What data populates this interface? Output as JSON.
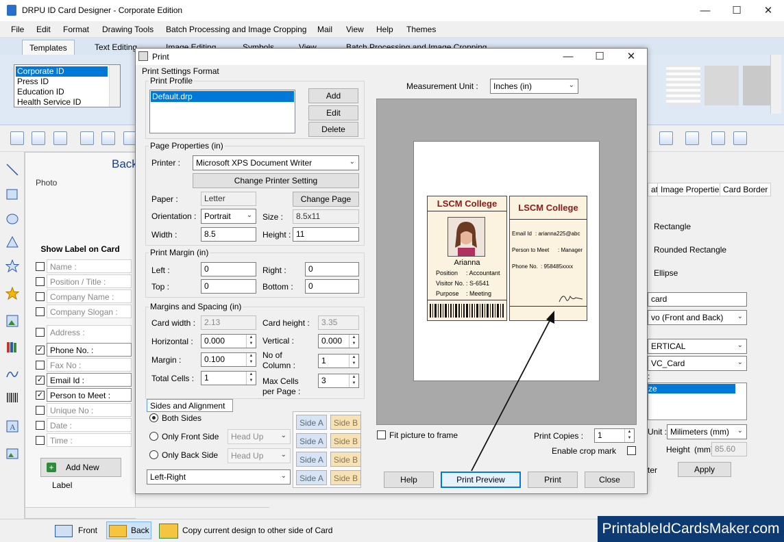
{
  "app": {
    "title": "DRPU ID Card Designer - Corporate Edition",
    "win_min": "—",
    "win_max": "☐",
    "win_close": "✕"
  },
  "menu": [
    "File",
    "Edit",
    "Format",
    "Drawing Tools",
    "Batch Processing and Image Cropping",
    "Mail",
    "View",
    "Help",
    "Themes"
  ],
  "tabs": [
    "Templates",
    "Text Editing",
    "Image Editing",
    "Symbols",
    "View",
    "Batch Processing and Image Cropping"
  ],
  "template_list": [
    "Corporate ID",
    "Press ID",
    "Education ID",
    "Health Service ID"
  ],
  "canvas": {
    "back_label": "Back"
  },
  "left_panel": {
    "photo_label": "Photo",
    "show_label_heading": "Show Label on Card",
    "labels": [
      {
        "text": "Name :",
        "checked": false
      },
      {
        "text": "Position / Title :",
        "checked": false
      },
      {
        "text": "Company Name :",
        "checked": false
      },
      {
        "text": "Company Slogan :",
        "checked": false
      },
      {
        "text": "Address :",
        "checked": false
      },
      {
        "text": "Phone No. :",
        "checked": true
      },
      {
        "text": "Fax No :",
        "checked": false
      },
      {
        "text": "Email Id :",
        "checked": true
      },
      {
        "text": "Person to Meet :",
        "checked": true
      },
      {
        "text": "Unique No :",
        "checked": false
      },
      {
        "text": "Date :",
        "checked": false
      },
      {
        "text": "Time :",
        "checked": false
      }
    ],
    "add_label_btn": "Add New Label"
  },
  "status": {
    "front": "Front",
    "back": "Back",
    "copy": "Copy current design to other side of Card"
  },
  "right_panel": {
    "tabs": [
      "at",
      "Image Properties",
      "Card Border"
    ],
    "shapes": [
      "Rectangle",
      "Rounded Rectangle",
      "Ellipse"
    ],
    "card_name": "card",
    "sides_combo": "vo (Front and Back)",
    "orientation_combo": "ERTICAL",
    "card_combo": "VC_Card",
    "colon": ":",
    "list_selected": "ze",
    "unit_label": "Unit :",
    "unit_value": "Milimeters (mm)",
    "height_label": "Height",
    "height_unit": "(mm)",
    "height_value": "85.60",
    "partial_btn": "ter",
    "apply_btn": "Apply"
  },
  "watermark": "PrintableIdCardsMaker.com",
  "dialog": {
    "title": "Print",
    "settings_format": "Print Settings Format",
    "print_profile": {
      "label": "Print Profile",
      "items": [
        "Default.drp"
      ],
      "add": "Add",
      "edit": "Edit",
      "delete": "Delete"
    },
    "page_props": {
      "label": "Page Properties  (in)",
      "printer_label": "Printer :",
      "printer_value": "Microsoft XPS Document Writer",
      "change_printer": "Change Printer Setting",
      "paper_label": "Paper :",
      "paper_value": "Letter",
      "change_page": "Change Page",
      "orientation_label": "Orientation :",
      "orientation_value": "Portrait",
      "size_label": "Size :",
      "size_value": "8.5x11",
      "width_label": "Width :",
      "width_value": "8.5",
      "height_label": "Height :",
      "height_value": "11"
    },
    "margin": {
      "label": "Print Margin (in)",
      "left_label": "Left :",
      "left_value": "0",
      "right_label": "Right :",
      "right_value": "0",
      "top_label": "Top :",
      "top_value": "0",
      "bottom_label": "Bottom :",
      "bottom_value": "0"
    },
    "spacing": {
      "label": "Margins and Spacing  (in)",
      "card_width_label": "Card width :",
      "card_width_value": "2.13",
      "card_height_label": "Card height :",
      "card_height_value": "3.35",
      "horizontal_label": "Horizontal :",
      "horizontal_value": "0.000",
      "vertical_label": "Vertical :",
      "vertical_value": "0.000",
      "margin_label": "Margin :",
      "margin_value": "0.100",
      "no_of_label": "No of",
      "column_label": "Column :",
      "column_value": "1",
      "total_cells_label": "Total Cells :",
      "total_cells_value": "1",
      "max_cells_label": "Max Cells",
      "per_page_label": "per Page :",
      "max_cells_value": "3"
    },
    "sides": {
      "label": "Sides and Alignment",
      "both": "Both Sides",
      "front_only": "Only Front Side",
      "back_only": "Only Back Side",
      "head_up_1": "Head Up",
      "head_up_2": "Head Up",
      "alignment": "Left-Right",
      "side_a": "Side A",
      "side_b": "Side B"
    },
    "measurement_label": "Measurement Unit :",
    "measurement_value": "Inches (in)",
    "card_front": {
      "college": "LSCM College",
      "name": "Arianna",
      "rows": [
        {
          "k": "Position",
          "v": ":  Accountant"
        },
        {
          "k": "Visitor No.",
          "v": ":  S-6541"
        },
        {
          "k": "Purpose",
          "v": ":  Meeting"
        }
      ]
    },
    "card_back": {
      "college": "LSCM College",
      "rows": [
        {
          "k": "Email Id",
          "v": ": arianna225@abc"
        },
        {
          "k": "Person to Meet",
          "v": ":  Manager"
        },
        {
          "k": "Phone No.",
          "v": ":  958485xxxx"
        }
      ]
    },
    "fit_label": "Fit picture to frame",
    "copies_label": "Print Copies :",
    "copies_value": "1",
    "crop_label": "Enable crop mark",
    "help": "Help",
    "print_preview": "Print Preview",
    "print": "Print",
    "close": "Close"
  }
}
